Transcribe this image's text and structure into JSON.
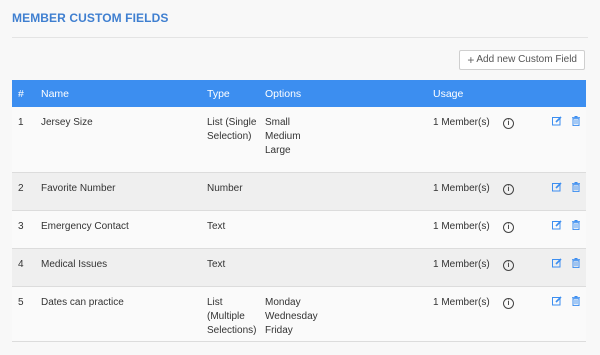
{
  "page": {
    "title": "MEMBER CUSTOM FIELDS",
    "add_button_label": "Add new Custom Field"
  },
  "table": {
    "headers": {
      "num": "#",
      "name": "Name",
      "type": "Type",
      "options": "Options",
      "usage": "Usage"
    },
    "rows": [
      {
        "num": "1",
        "name": "Jersey Size",
        "type": [
          "List (Single",
          "Selection)"
        ],
        "options": [
          "Small",
          "Medium",
          "Large"
        ],
        "usage": "1 Member(s)"
      },
      {
        "num": "2",
        "name": "Favorite Number",
        "type": [
          "Number"
        ],
        "options": [],
        "usage": "1 Member(s)"
      },
      {
        "num": "3",
        "name": "Emergency Contact",
        "type": [
          "Text"
        ],
        "options": [],
        "usage": "1 Member(s)"
      },
      {
        "num": "4",
        "name": "Medical Issues",
        "type": [
          "Text"
        ],
        "options": [],
        "usage": "1 Member(s)"
      },
      {
        "num": "5",
        "name": "Dates can practice",
        "type": [
          "List",
          "(Multiple",
          "Selections)"
        ],
        "options": [
          "Monday",
          "Wednesday",
          "Friday"
        ],
        "usage": "1 Member(s)"
      }
    ]
  },
  "icons": {
    "info": "info-icon",
    "edit": "edit-icon",
    "delete": "trash-icon",
    "add": "plus-icon"
  },
  "colors": {
    "accent": "#3c8ef0",
    "title": "#3f7fd0"
  }
}
